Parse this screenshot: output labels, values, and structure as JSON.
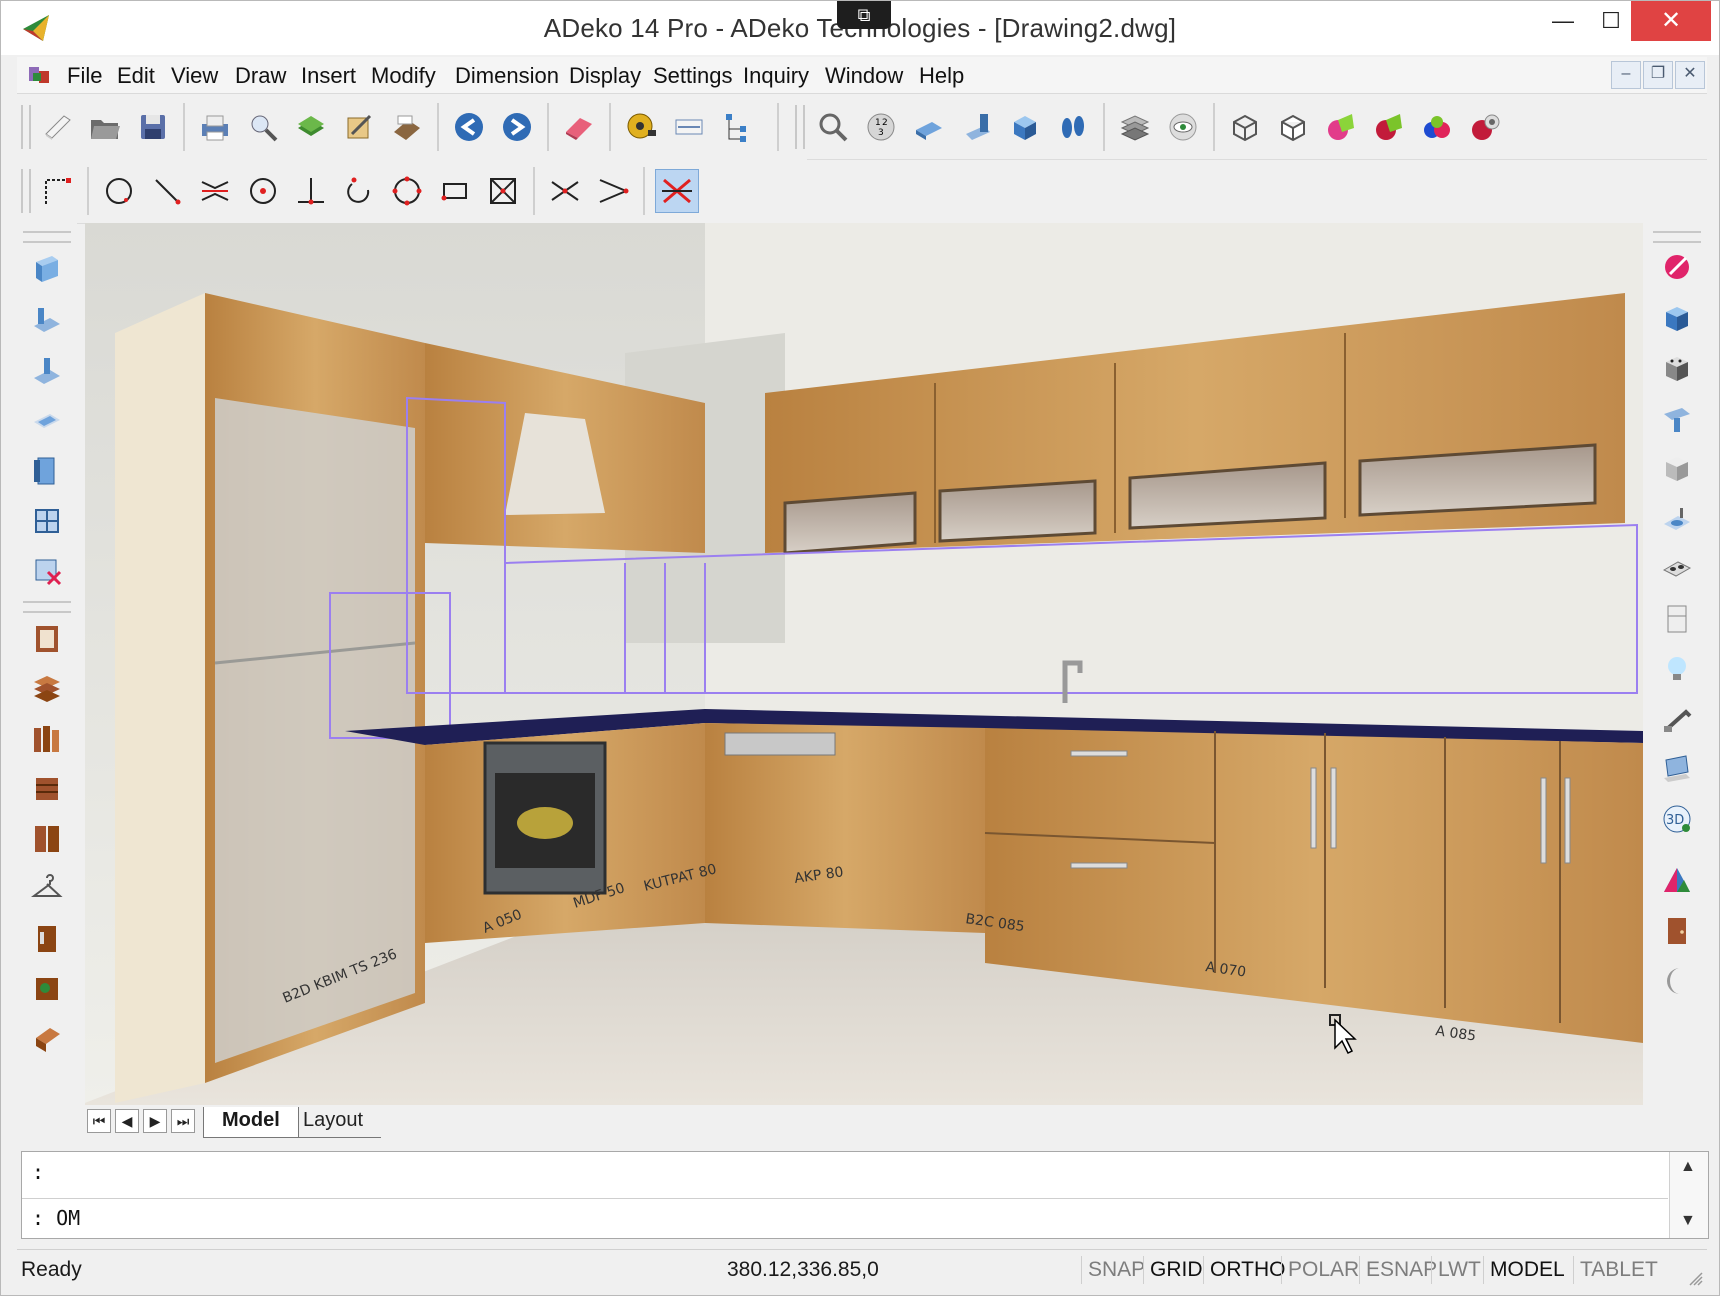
{
  "window": {
    "title": "ADeko 14 Pro  - ADeko Technologies - [Drawing2.dwg]",
    "min_glyph": "—",
    "max_glyph": "☐",
    "close_glyph": "✕",
    "capture_glyph": "⧉"
  },
  "menu": {
    "items": [
      "File",
      "Edit",
      "View",
      "Draw",
      "Insert",
      "Modify",
      "Dimension",
      "Display",
      "Settings",
      "Inquiry",
      "Window",
      "Help"
    ],
    "mdi_min": "–",
    "mdi_restore": "❐",
    "mdi_close": "✕"
  },
  "toolbar_standard": {
    "icons": [
      "new-file-icon",
      "open-folder-icon",
      "save-disk-icon",
      "print-icon",
      "print-preview-icon",
      "layer-stack-icon",
      "object-properties-icon",
      "plot-icon",
      "undo-icon",
      "redo-icon",
      "eraser-icon",
      "measure-tape-icon",
      "dimension-icon",
      "tree-icon",
      "zoom-icon",
      "zoom-numbered-icon",
      "view-top-icon",
      "view-side-icon",
      "view-box-icon",
      "footprint-icon",
      "layers-icon",
      "eye-icon",
      "wireframe-cube-icon",
      "hidden-cube-icon",
      "shade-green-icon",
      "shade-red-icon",
      "shade-color-icon",
      "render-icon"
    ]
  },
  "toolbar_draw": {
    "icons": [
      "polyline-icon",
      "circle-icon",
      "line-icon",
      "mirror-icon",
      "center-circle-icon",
      "perpendicular-icon",
      "arc-icon",
      "polygon-icon",
      "rectangle-icon",
      "cross-box-icon",
      "trim-icon",
      "extend-icon",
      "osnap-intersection-icon"
    ]
  },
  "left_sidebar": {
    "icons": [
      "wall-panel-icon",
      "floor-icon",
      "ceiling-icon",
      "window-frame-icon",
      "door-icon",
      "grid-window-icon",
      "delete-wall-icon",
      "cabinet-frame-icon",
      "shelf-stack-icon",
      "panel-row-icon",
      "drawer-icon",
      "door-pair-icon",
      "hanger-icon",
      "handle-icon",
      "worktop-icon",
      "plinth-icon"
    ]
  },
  "right_sidebar": {
    "icons": [
      "paint-icon",
      "cube-blue-icon",
      "appliance-icon",
      "hood-icon",
      "box-corner-icon",
      "sink-icon",
      "cooktop-icon",
      "fridge-icon",
      "light-bulb-icon",
      "faucet-icon",
      "monitor-icon",
      "view-3d-icon",
      "material-triangle-icon",
      "door-brown-icon",
      "moon-icon"
    ]
  },
  "tabs": {
    "nav": [
      "⏮",
      "◀",
      "▶",
      "⏭"
    ],
    "model": "Model",
    "layout": "Layout"
  },
  "command": {
    "line1": ":",
    "line2": ": OM",
    "scroll_up": "▲",
    "scroll_down": "▼"
  },
  "status": {
    "ready": "Ready",
    "coords": "380.12,336.85,0",
    "toggles": [
      {
        "label": "SNAP",
        "on": false
      },
      {
        "label": "GRID",
        "on": true
      },
      {
        "label": "ORTHO",
        "on": true
      },
      {
        "label": "POLAR",
        "on": false
      },
      {
        "label": "ESNAP",
        "on": false
      },
      {
        "label": "LWT",
        "on": false
      },
      {
        "label": "MODEL",
        "on": true
      },
      {
        "label": "TABLET",
        "on": false
      }
    ]
  },
  "viewport": {
    "floor_labels": [
      "B2D KBIM TS 236",
      "A 050",
      "MDF 50",
      "KUTPAT 80",
      "AKP 80",
      "B2C 085",
      "A 070",
      "A 085"
    ]
  },
  "colors": {
    "accent_selected": "#bcd6f2",
    "close_red": "#e04343",
    "wood": "#c8954e",
    "selection_purple": "#9b7ff0",
    "worktop": "#1f1f55"
  }
}
